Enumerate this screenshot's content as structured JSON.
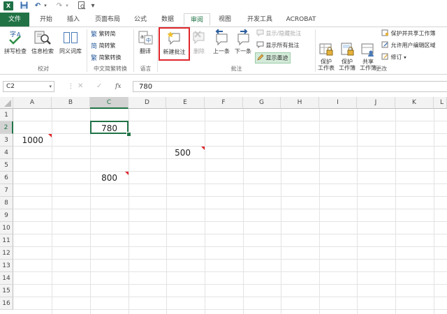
{
  "quick_access": {
    "undo": "↶",
    "redo": "↷",
    "customize": "▾"
  },
  "tabs": [
    "文件",
    "开始",
    "插入",
    "页面布局",
    "公式",
    "数据",
    "审阅",
    "视图",
    "开发工具",
    "ACROBAT"
  ],
  "active_tab": "审阅",
  "ribbon": {
    "proofing": {
      "label": "校对",
      "spell": "拼写检查",
      "research": "信息检索",
      "thesaurus": "同义词库"
    },
    "chinese": {
      "label": "中文简繁转换",
      "t2s": "繁转简",
      "s2t": "简转繁",
      "convert": "简繁转换"
    },
    "language": {
      "label": "语言",
      "translate": "翻译"
    },
    "comments": {
      "label": "批注",
      "new": "新建批注",
      "delete": "删除",
      "prev": "上一条",
      "next": "下一条",
      "show_hide": "显示/隐藏批注",
      "show_all": "显示所有批注",
      "show_ink": "显示墨迹"
    },
    "changes": {
      "label": "更改",
      "protect_sheet": "保护\n工作表",
      "protect_wb": "保护\n工作簿",
      "share_wb": "共享\n工作簿",
      "protect_share": "保护并共享工作簿",
      "allow_edit": "允许用户编辑区域",
      "track": "修订"
    }
  },
  "formula_bar": {
    "name_box": "C2",
    "fx": "fx",
    "value": "780"
  },
  "columns": [
    "A",
    "B",
    "C",
    "D",
    "E",
    "F",
    "G",
    "H",
    "I",
    "J",
    "K",
    "L"
  ],
  "rows": [
    "1",
    "2",
    "3",
    "4",
    "5",
    "6",
    "7",
    "8",
    "9",
    "10",
    "11",
    "12",
    "13",
    "14",
    "15",
    "16"
  ],
  "cells": {
    "C2": "780",
    "A3": "1000",
    "E4": "500",
    "C6": "800"
  },
  "accent_color": "#217346",
  "highlight_color": "#e0262b"
}
